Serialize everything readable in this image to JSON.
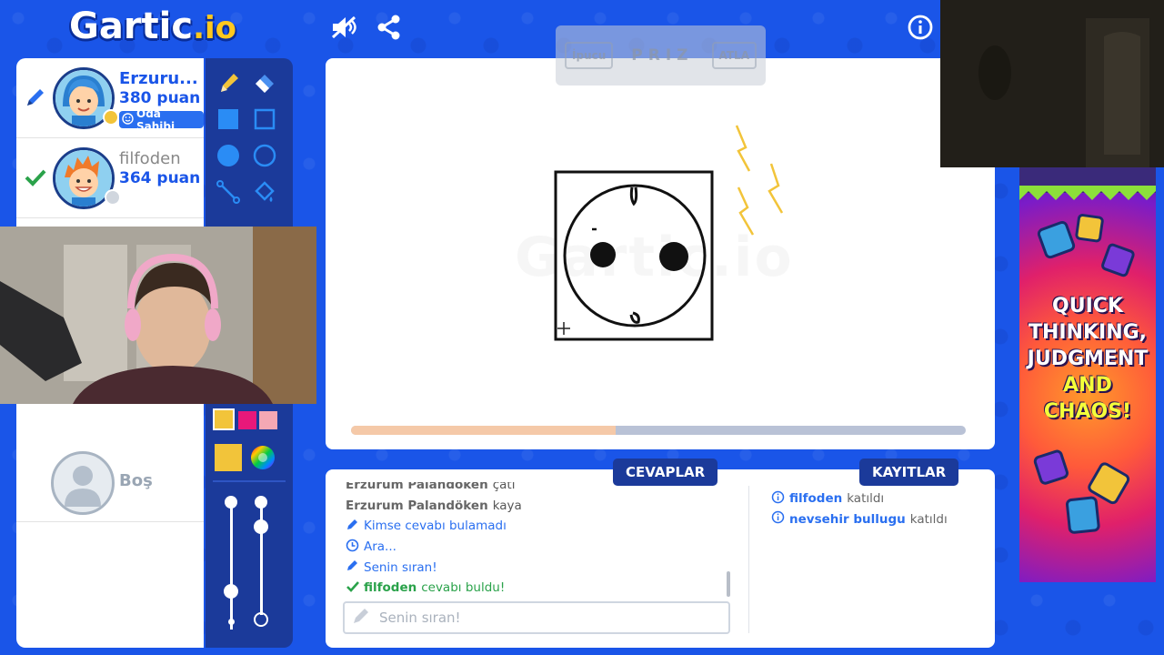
{
  "logo": {
    "main": "Gartic",
    "suffix": ".io"
  },
  "top_bar": {
    "sound_icon": "sound-muted-icon",
    "share_icon": "share-icon",
    "info_icon": "info-icon"
  },
  "players": [
    {
      "name": "Erzuru...",
      "score": "380 puan",
      "badge": "Oda Sahibi",
      "status": "drawing"
    },
    {
      "name": "filfoden",
      "score": "364 puan",
      "status": "guessed"
    }
  ],
  "empty_slot": {
    "label": "Boş"
  },
  "hint": {
    "left_button": "İpucu",
    "word": "PRIZ",
    "right_button": "ATLA"
  },
  "canvas": {
    "watermark": "Gartic.io",
    "progress": 0.43
  },
  "tabs": {
    "answers": "CEVAPLAR",
    "logs": "KAYITLAR"
  },
  "chat": {
    "messages": [
      {
        "who": "Erzurum Palandöken",
        "text": "çatı",
        "type": "guess"
      },
      {
        "who": "Erzurum Palandöken",
        "text": "kaya",
        "type": "guess"
      },
      {
        "who": "",
        "text": "Kimse cevabı bulamadı",
        "type": "pencil"
      },
      {
        "who": "",
        "text": "Ara...",
        "type": "clock"
      },
      {
        "who": "",
        "text": "Senin sıran!",
        "type": "pencil"
      },
      {
        "who": "filfoden",
        "text": "cevabı buldu!",
        "type": "correct"
      }
    ],
    "placeholder": "Senin sıran!"
  },
  "logs": [
    {
      "who": "filfoden",
      "text": "katıldı"
    },
    {
      "who": "nevsehir bullugu",
      "text": "katıldı"
    }
  ],
  "ad": {
    "line1": "QUICK",
    "line2": "THINKING,",
    "line3": "JUDGMENT",
    "line4": "AND",
    "line5": "CHAOS!"
  },
  "colors": {
    "primary_blue": "#1a55e8",
    "dark_blue": "#1b3a9a",
    "green": "#2aa24a",
    "yellow": "#f2c43a"
  }
}
